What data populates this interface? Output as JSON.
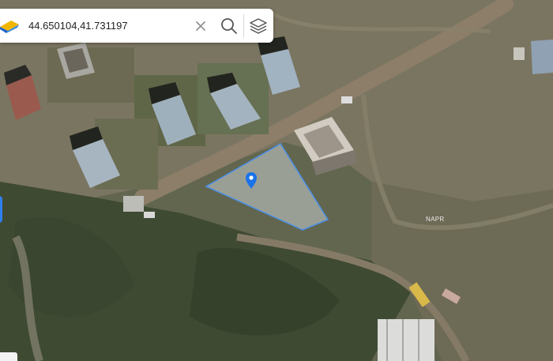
{
  "search": {
    "query": "44.650104,41.731197"
  },
  "icons": {
    "logo": "app-logo-icon",
    "clear": "close-icon",
    "search": "search-icon",
    "layers": "layers-icon",
    "marker": "location-pin-icon"
  },
  "map": {
    "label_napr": "NAPR",
    "type": "satellite"
  },
  "colors": {
    "parcel_outline": "#4b90e8",
    "marker": "#1a73e8",
    "edge_tab": "#2f7ff0"
  }
}
